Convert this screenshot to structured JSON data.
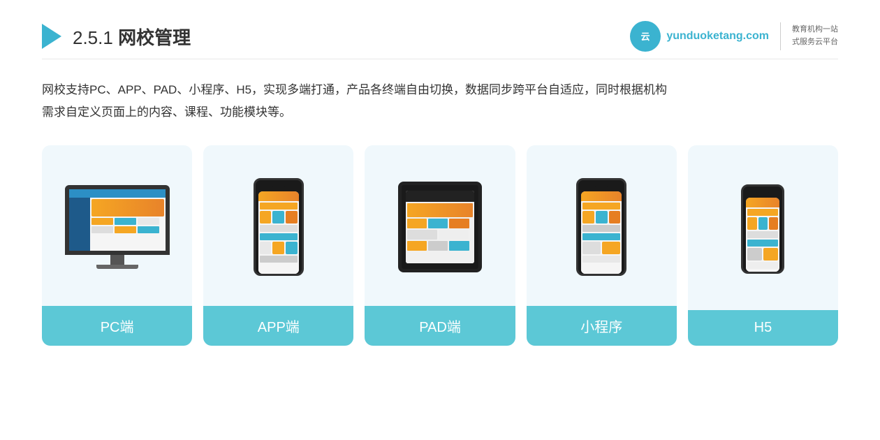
{
  "header": {
    "title_prefix": "2.5.1 ",
    "title_bold": "网校管理",
    "logo": {
      "site": "yunduoketang.com",
      "tagline_line1": "教育机构一站",
      "tagline_line2": "式服务云平台"
    }
  },
  "description": {
    "line1": "网校支持PC、APP、PAD、小程序、H5，实现多端打通，产品各终端自由切换，数据同步跨平台自适应，同时根据机构",
    "line2": "需求自定义页面上的内容、课程、功能模块等。"
  },
  "cards": [
    {
      "id": "pc",
      "label": "PC端",
      "device": "monitor"
    },
    {
      "id": "app",
      "label": "APP端",
      "device": "phone"
    },
    {
      "id": "pad",
      "label": "PAD端",
      "device": "tablet"
    },
    {
      "id": "miniapp",
      "label": "小程序",
      "device": "phone"
    },
    {
      "id": "h5",
      "label": "H5",
      "device": "phone-small"
    }
  ],
  "colors": {
    "teal": "#5cc8d6",
    "card_bg": "#eef7fb",
    "dark": "#333",
    "accent_orange": "#f5a623",
    "accent_blue": "#2c8fc5"
  }
}
